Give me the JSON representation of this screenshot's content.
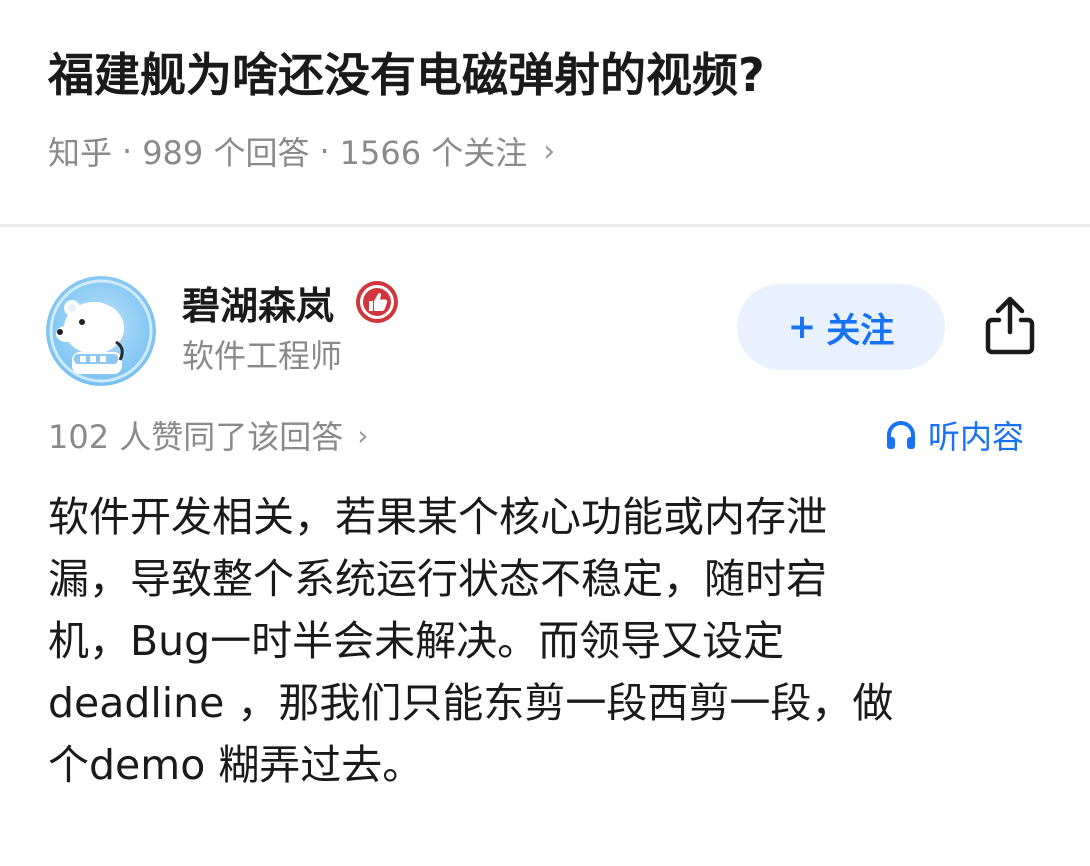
{
  "question": {
    "title": "福建舰为啥还没有电磁弹射的视频?",
    "meta": {
      "source": "知乎",
      "answers": "989 个回答",
      "followers": "1566 个关注",
      "chevron": "›"
    }
  },
  "author": {
    "name": "碧湖森岚",
    "headline": "软件工程师",
    "avatar_icon": "polar-bear-avatar",
    "badge_icon": "thumbs-up-badge-icon"
  },
  "actions": {
    "follow_plus": "+",
    "follow_label": "关注",
    "share_icon": "share-icon"
  },
  "answer": {
    "votes": "102 人赞同了该回答",
    "votes_chevron": "›",
    "listen_label": "听内容",
    "listen_icon": "headphones-icon",
    "lines": [
      "软件开发相关，若果某个核心功能或内存泄",
      "漏，导致整个系统运行状态不稳定，随时宕",
      "机，Bug一时半会未解决。而领导又设定",
      "deadline ，那我们只能东剪一段西剪一段，做",
      "个demo 糊弄过去。"
    ]
  },
  "colors": {
    "accent": "#1772f6",
    "follow_bg": "#e9f1fe",
    "muted_text": "#8a8a8a",
    "badge_red": "#d0373d"
  }
}
